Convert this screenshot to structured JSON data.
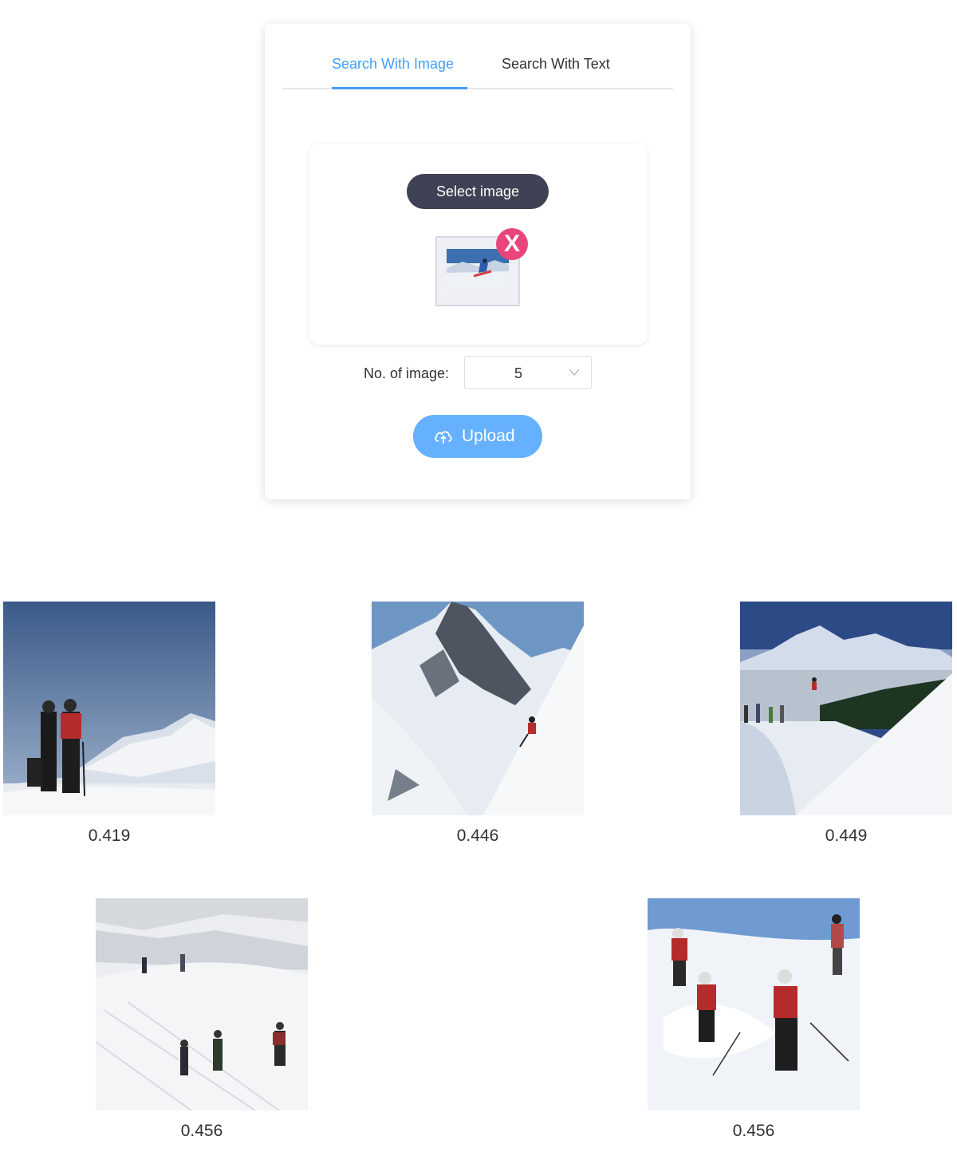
{
  "tabs": {
    "image_label": "Search With Image",
    "text_label": "Search With Text"
  },
  "upload_area": {
    "select_label": "Select image",
    "remove_label": "X"
  },
  "count": {
    "label": "No. of image:",
    "value": "5"
  },
  "upload_button": {
    "label": "Upload"
  },
  "results": [
    {
      "score": "0.419"
    },
    {
      "score": "0.446"
    },
    {
      "score": "0.449"
    },
    {
      "score": "0.456"
    },
    {
      "score": "0.456"
    }
  ],
  "colors": {
    "accent": "#409eff",
    "upload_button": "#66b1ff",
    "select_button": "#3f4254",
    "remove_badge": "#e8457a"
  }
}
